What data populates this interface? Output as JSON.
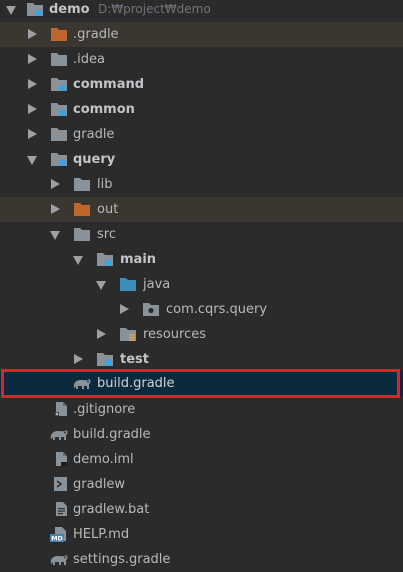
{
  "root": {
    "label": "demo",
    "path": "D:₩project₩demo"
  },
  "items": {
    "gradle_dir": ".gradle",
    "idea": ".idea",
    "command": "command",
    "common": "common",
    "gradle": "gradle",
    "query": "query",
    "lib": "lib",
    "out": "out",
    "src": "src",
    "main": "main",
    "java": "java",
    "package": "com.cqrs.query",
    "resources": "resources",
    "test": "test",
    "query_build": "build.gradle",
    "gitignore": ".gitignore",
    "root_build": "build.gradle",
    "demo_iml": "demo.iml",
    "gradlew": "gradlew",
    "gradlew_bat": "gradlew.bat",
    "help_md": "HELP.md",
    "settings": "settings.gradle"
  },
  "icon_text": {
    "md": "MD"
  },
  "colors": {
    "background": "#2b2b2b",
    "selected_row": "#0d293e",
    "excluded_row": "#3a3630",
    "folder_gray": "#8a9299",
    "folder_orange": "#c0662a",
    "folder_blue": "#3d8fb8",
    "module_marker": "#3da3e0",
    "highlight_border": "#e0202a"
  }
}
